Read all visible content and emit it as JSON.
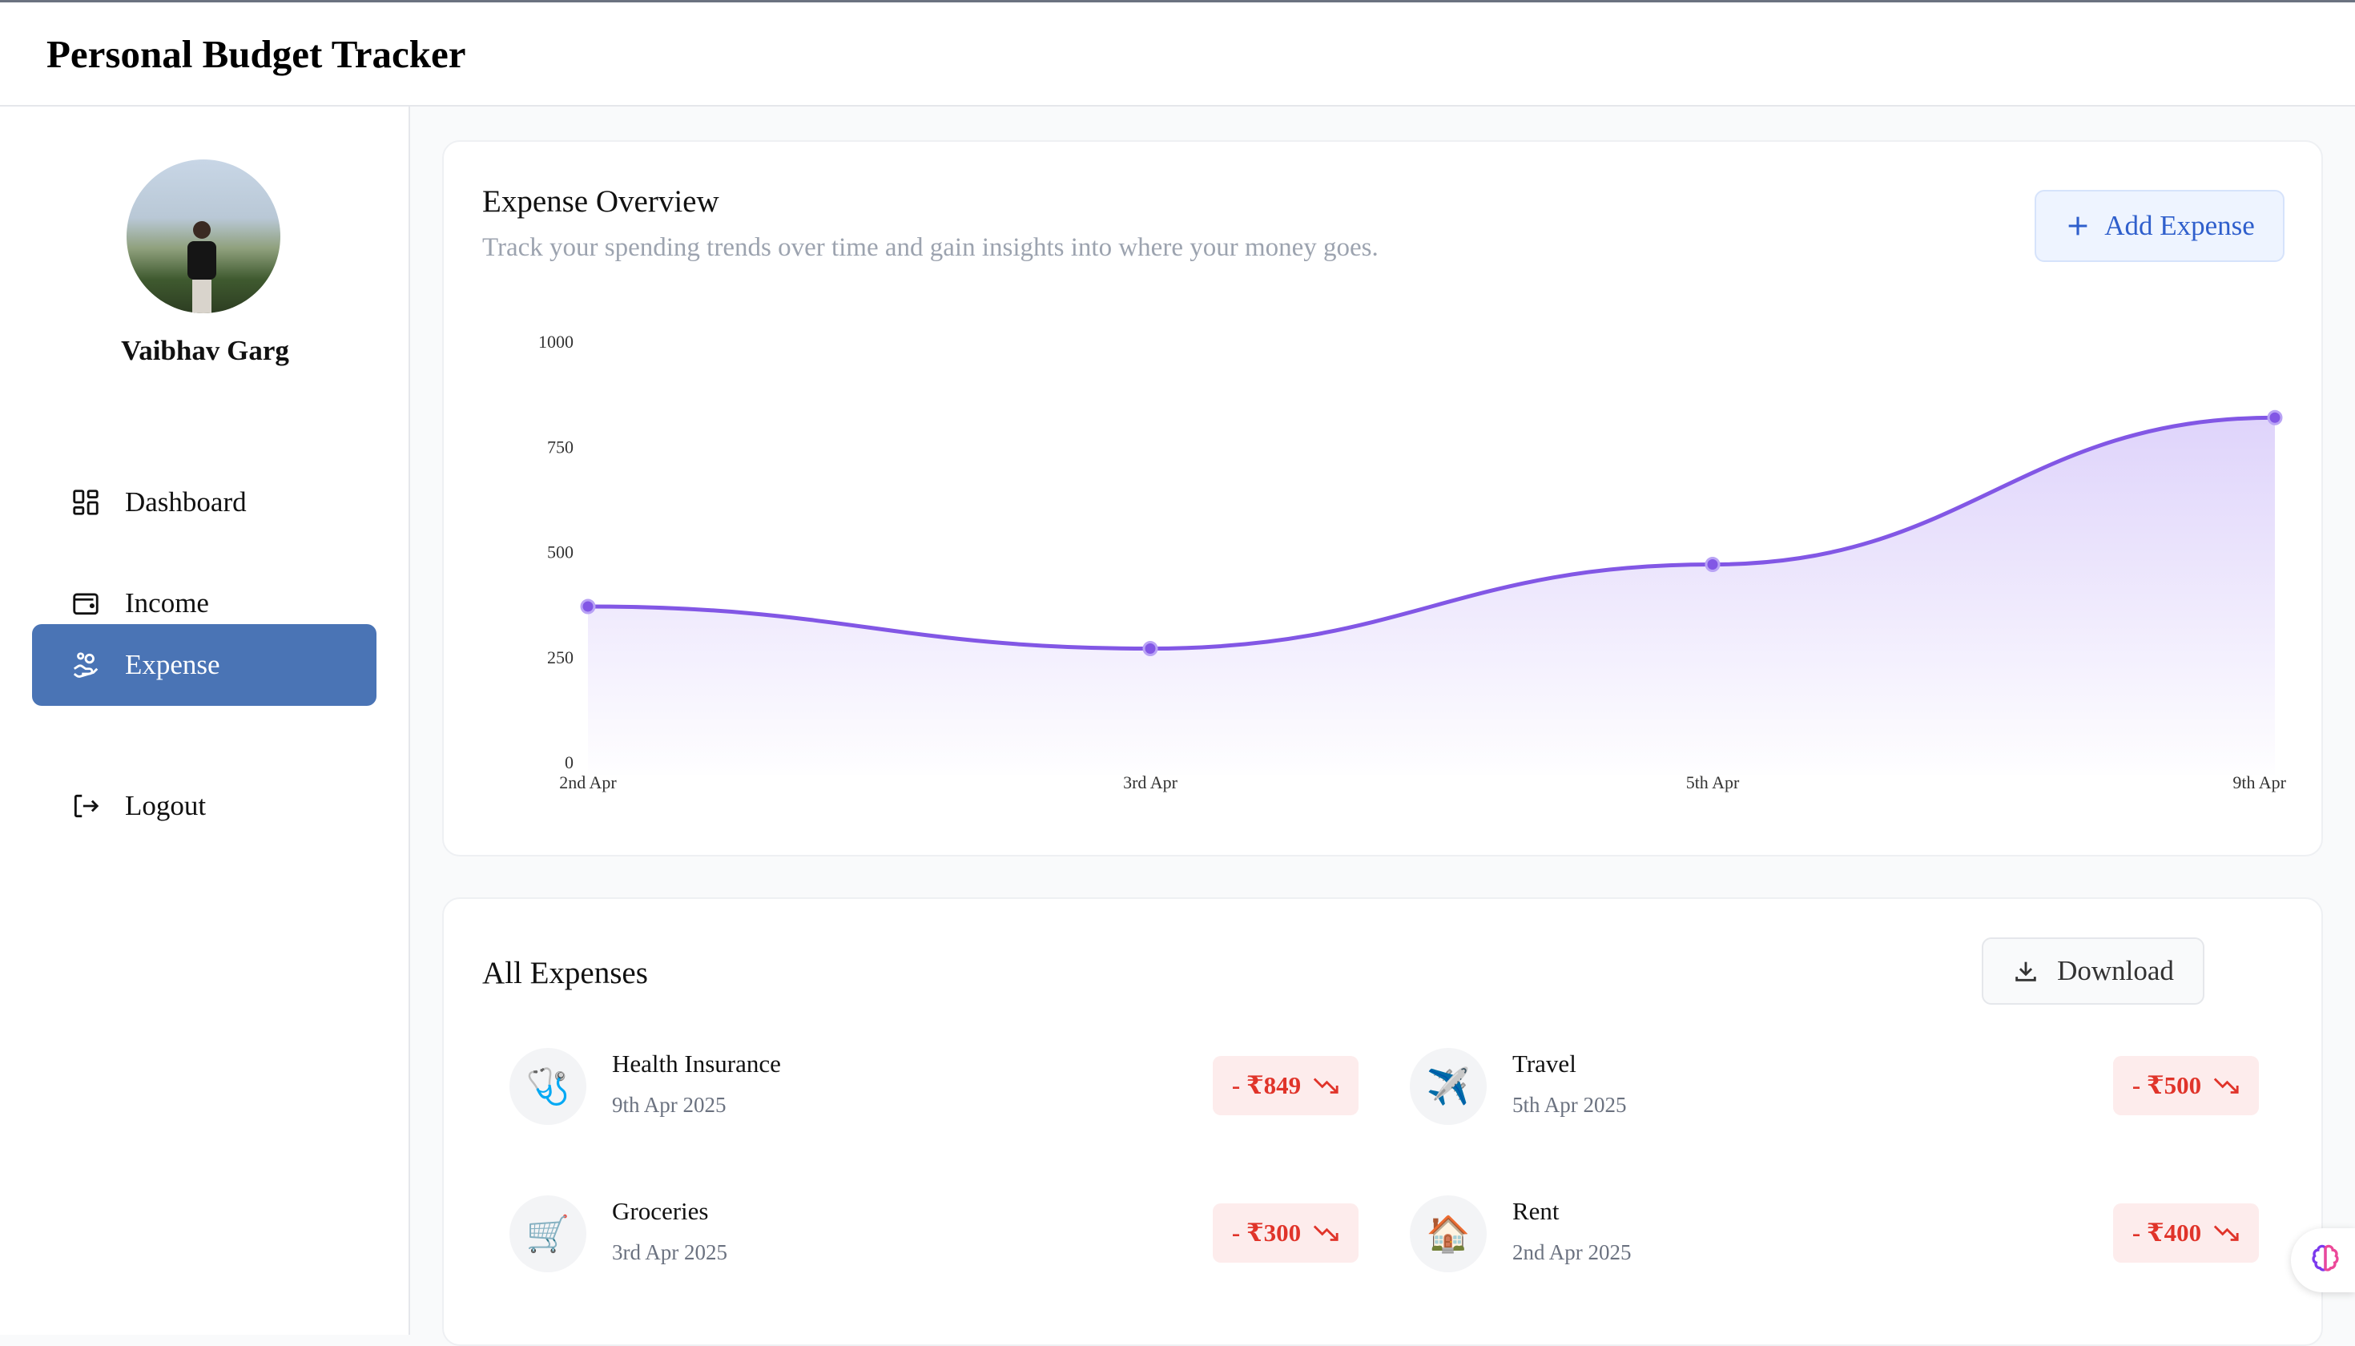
{
  "app": {
    "title": "Personal Budget Tracker"
  },
  "user": {
    "name": "Vaibhav Garg"
  },
  "sidebar": {
    "items": [
      {
        "label": "Dashboard",
        "icon": "dashboard-icon",
        "active": false
      },
      {
        "label": "Income",
        "icon": "wallet-icon",
        "active": false
      },
      {
        "label": "Expense",
        "icon": "hand-coins-icon",
        "active": true
      },
      {
        "label": "Logout",
        "icon": "logout-icon",
        "active": false
      }
    ]
  },
  "overview": {
    "title": "Expense Overview",
    "subtitle": "Track your spending trends over time and gain insights into where your money goes.",
    "add_label": "Add Expense"
  },
  "chart_data": {
    "type": "area",
    "categories": [
      "2nd Apr",
      "3rd Apr",
      "5th Apr",
      "9th Apr"
    ],
    "values": [
      400,
      300,
      500,
      849
    ],
    "y_ticks": [
      "0",
      "250",
      "500",
      "750",
      "1000"
    ],
    "ylim": [
      0,
      1000
    ],
    "grid": false,
    "line_color": "#8257e5",
    "fill_color": "#d9ccfa"
  },
  "expenses": {
    "title": "All Expenses",
    "download_label": "Download",
    "items": [
      {
        "name": "Health Insurance",
        "date": "9th Apr 2025",
        "amount": "- ₹849",
        "icon": "stethoscope-icon",
        "glyph": "🩺"
      },
      {
        "name": "Travel",
        "date": "5th Apr 2025",
        "amount": "- ₹500",
        "icon": "airplane-icon",
        "glyph": "✈️"
      },
      {
        "name": "Groceries",
        "date": "3rd Apr 2025",
        "amount": "- ₹300",
        "icon": "shopping-cart-icon",
        "glyph": "🛒"
      },
      {
        "name": "Rent",
        "date": "2nd Apr 2025",
        "amount": "- ₹400",
        "icon": "house-icon",
        "glyph": "🏠"
      }
    ]
  },
  "colors": {
    "accent": "#4a74b5",
    "expense_red": "#e0342a",
    "chart_purple": "#8257e5"
  }
}
